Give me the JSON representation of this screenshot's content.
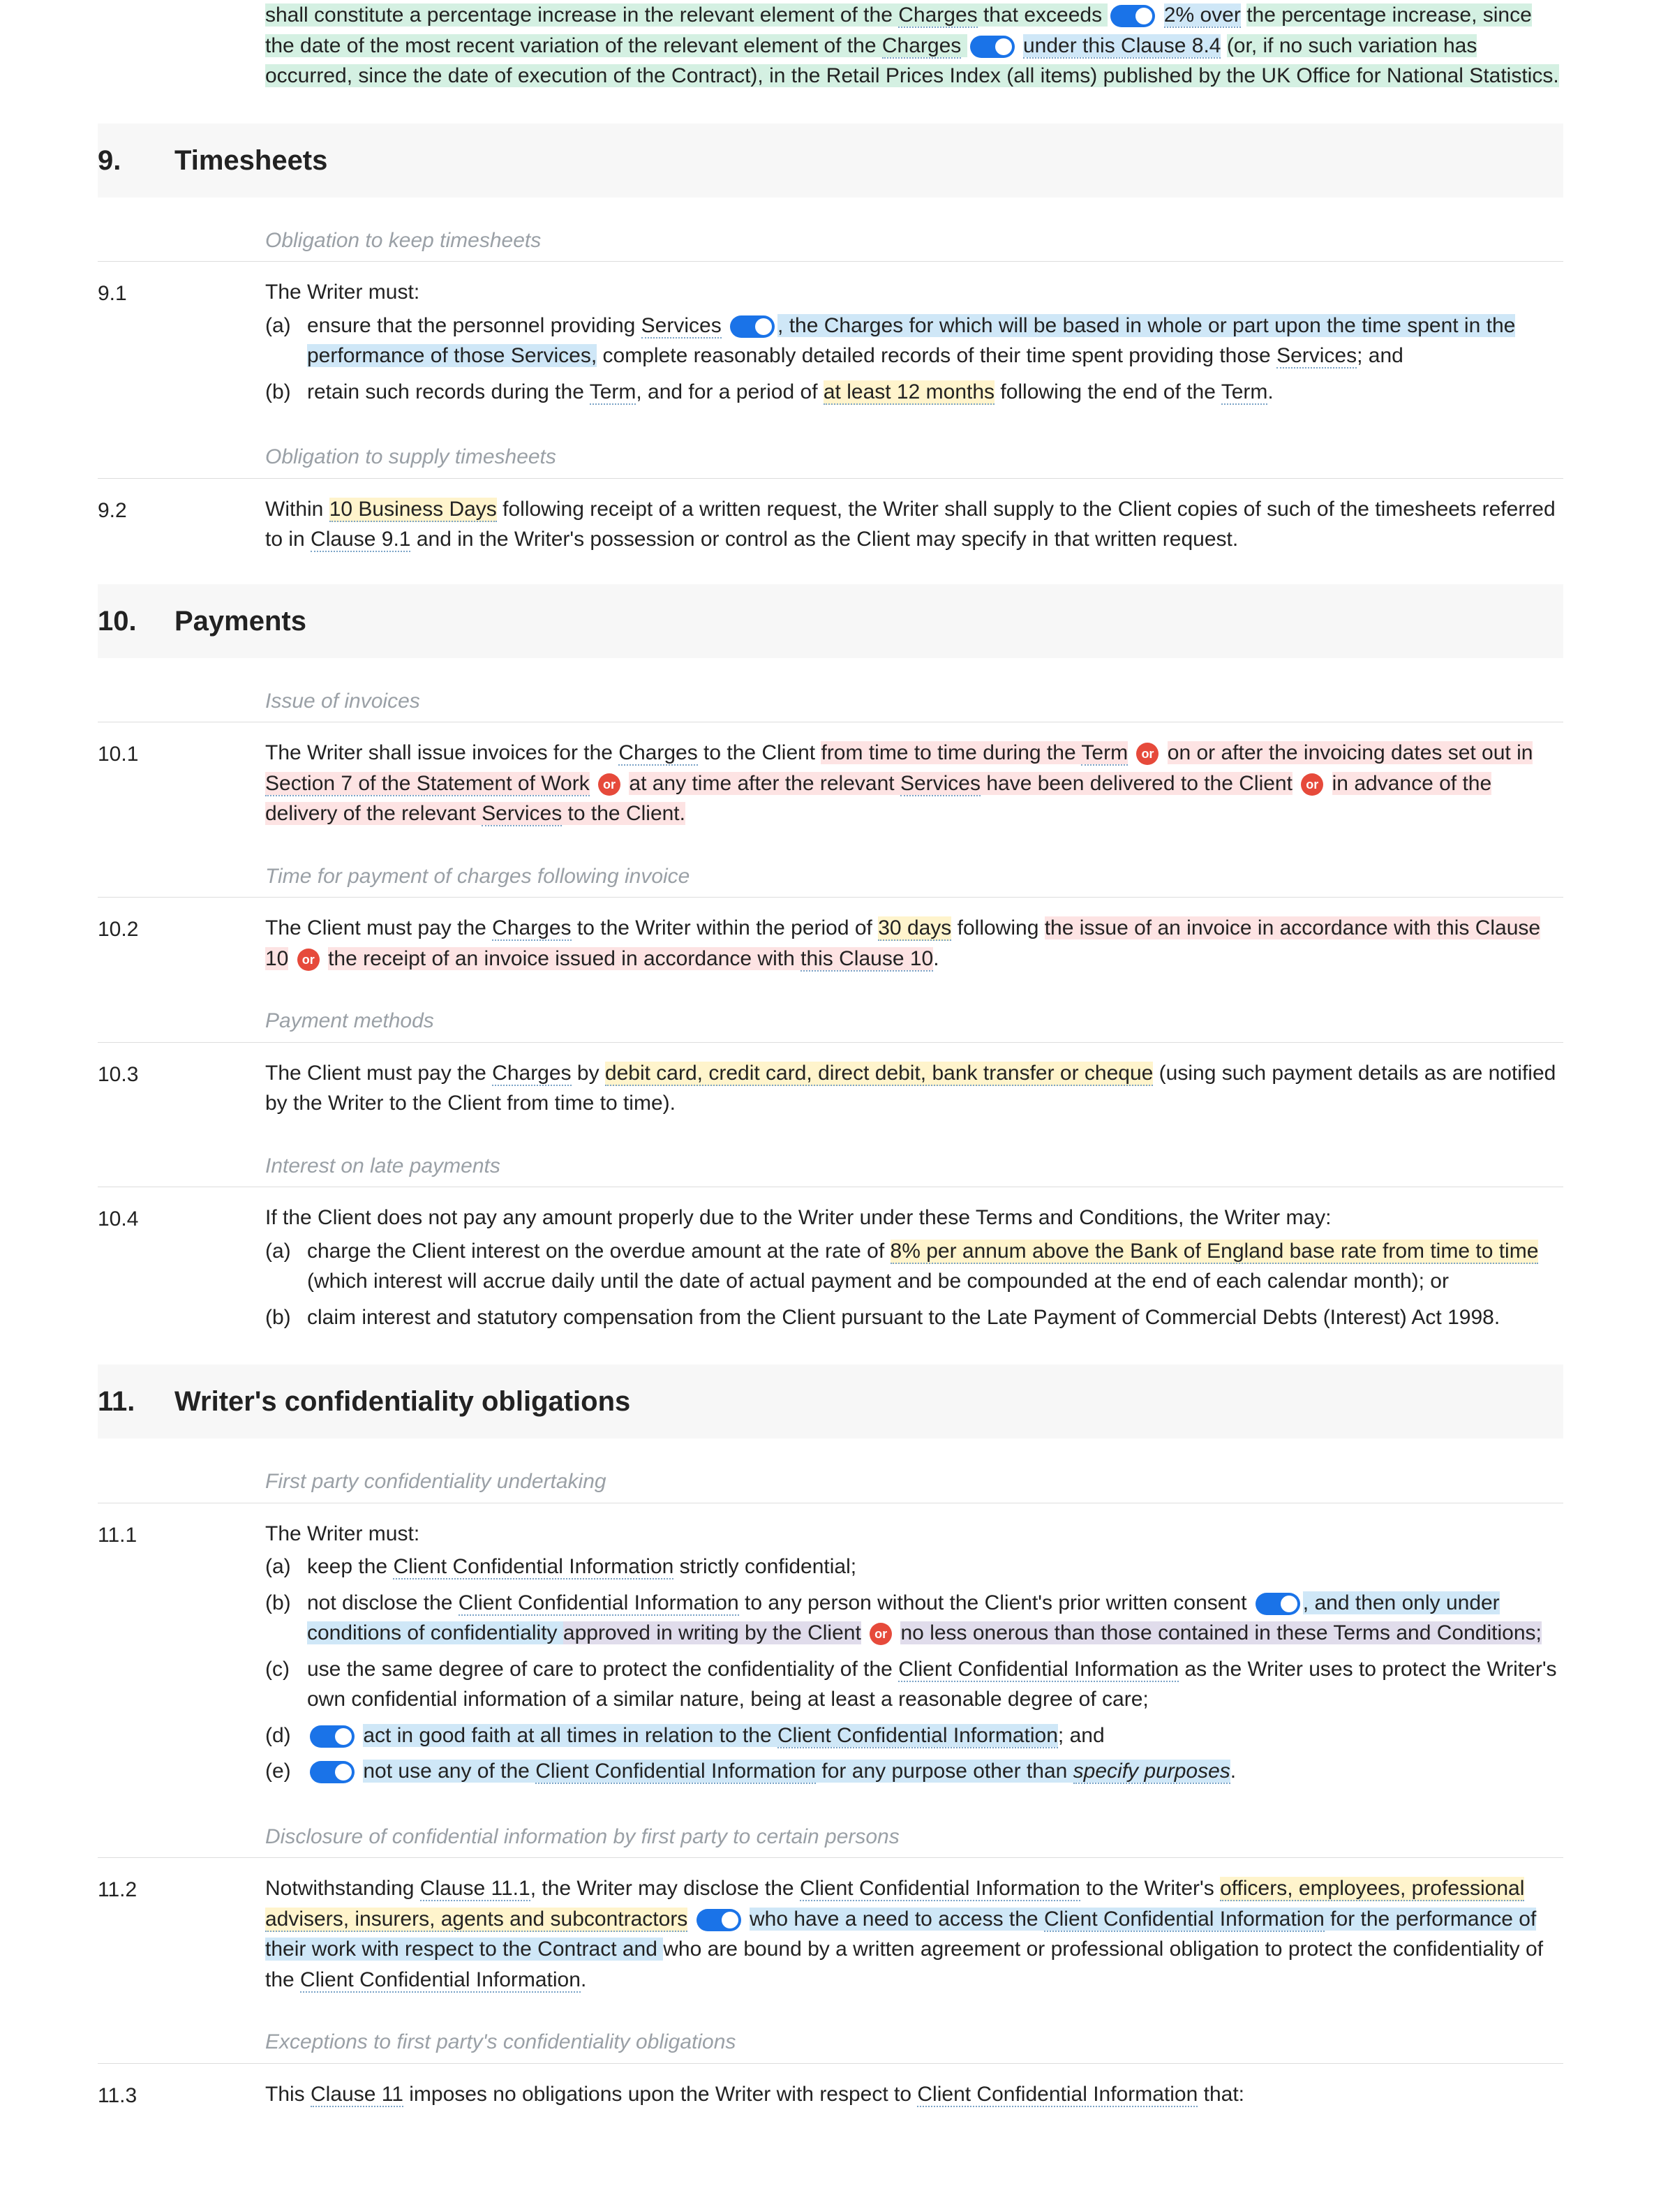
{
  "top": {
    "p1a": "shall constitute a percentage increase in the relevant element of the ",
    "charges": "Charges",
    "p1b": " that exceeds ",
    "pct": "2% over",
    "p1c": " the percentage increase, since the date of the most recent variation of the relevant element of the ",
    "p1d": "under this Clause 8.4",
    "p1e": " (or, if no such variation has occurred, since the date of execution of the Contract), in the Retail Prices Index (all items) published by the UK Office for National Statistics."
  },
  "s9": {
    "num": "9.",
    "title": "Timesheets",
    "cap1": "Obligation to keep timesheets",
    "c91n": "9.1",
    "c91lead": "The Writer must:",
    "c91a_l": "(a)",
    "c91a_1": "ensure that the personnel providing ",
    "services": "Services",
    "c91a_2": ", the Charges for which will be based in whole or part upon the time spent in the performance of those Services,",
    "c91a_3": " complete reasonably detailed records of their time spent providing those ",
    "c91a_4": "; and",
    "c91b_l": "(b)",
    "c91b_1": "retain such records during the ",
    "term": "Term",
    "c91b_2": ", and for a period of ",
    "c91b_3": "at least 12 months",
    "c91b_4": " following the end of the ",
    "c91b_5": ".",
    "cap2": "Obligation to supply timesheets",
    "c92n": "9.2",
    "c92_1": "Within ",
    "c92_2": "10 Business Days",
    "c92_3": " following receipt of a written request, the Writer shall supply to the Client copies of such of the timesheets referred to in ",
    "c92_4": "Clause 9.1",
    "c92_5": " and in the Writer's possession or control as the Client may specify in that written request."
  },
  "s10": {
    "num": "10.",
    "title": "Payments",
    "cap1": "Issue of invoices",
    "c101n": "10.1",
    "c101_1": "The Writer shall issue invoices for the ",
    "c101_2": " to the Client ",
    "c101_3": "from time to time during the ",
    "c101_4": " on or after the invoicing dates set out in ",
    "c101_5": "Section 7 of the Statement of Work",
    "c101_6": " at any time after the relevant ",
    "c101_7": " have been delivered to the Client",
    "c101_8": " in advance of the delivery of the relevant ",
    "c101_9": " to the Client.",
    "cap2": "Time for payment of charges following invoice",
    "c102n": "10.2",
    "c102_1": "The Client must pay the ",
    "c102_2": " to the Writer within the period of ",
    "c102_3": "30 days",
    "c102_4": " following ",
    "c102_5": "the issue of an invoice in accordance with this Clause 10",
    "c102_6": "the receipt of an invoice issued in accordance with ",
    "c102_7": "this Clause 10",
    "c102_8": ".",
    "cap3": "Payment methods",
    "c103n": "10.3",
    "c103_1": "The Client must pay the ",
    "c103_2": " by ",
    "c103_3": "debit card, credit card, direct debit, bank transfer or cheque",
    "c103_4": " (using such payment details as are notified by the Writer to the Client from time to time).",
    "cap4": "Interest on late payments",
    "c104n": "10.4",
    "c104lead": "If the Client does not pay any amount properly due to the Writer under these Terms and Conditions, the Writer may:",
    "c104a_l": "(a)",
    "c104a_1": "charge the Client interest on the overdue amount at the rate of ",
    "c104a_2": "8% per annum above the Bank of England base rate from time to time",
    "c104a_3": " (which interest will accrue daily until the date of actual payment and be compounded at the end of each calendar month); or",
    "c104b_l": "(b)",
    "c104b_1": "claim interest and statutory compensation from the Client pursuant to the Late Payment of Commercial Debts (Interest) Act 1998."
  },
  "s11": {
    "num": "11.",
    "title": "Writer's confidentiality obligations",
    "cap1": "First party confidentiality undertaking",
    "c111n": "11.1",
    "c111lead": "The Writer must:",
    "cci": "Client Confidential Information",
    "c111a_l": "(a)",
    "c111a_1": "keep the ",
    "c111a_2": " strictly confidential;",
    "c111b_l": "(b)",
    "c111b_1": "not disclose the ",
    "c111b_2": " to any person without the Client's prior written consent",
    "c111b_3": ", and then only under conditions of confidentiality ",
    "c111b_4": "approved in writing by the Client",
    "c111b_5": "no less onerous than those contained in these Terms and Conditions;",
    "c111c_l": "(c)",
    "c111c_1": "use the same degree of care to protect the confidentiality of the ",
    "c111c_2": " as the Writer uses to protect the Writer's own confidential information of a similar nature, being at least a reasonable degree of care;",
    "c111d_l": "(d)",
    "c111d_1": "act in good faith at all times in relation to the ",
    "c111d_2": "; and",
    "c111e_l": "(e)",
    "c111e_1": "not use any of the ",
    "c111e_2": " for any purpose other than ",
    "c111e_3": "specify purposes",
    "c111e_4": ".",
    "cap2": "Disclosure of confidential information by first party to certain persons",
    "c112n": "11.2",
    "c112_1": "Notwithstanding ",
    "c112_2": "Clause 11.1",
    "c112_3": ", the Writer may disclose the ",
    "c112_4": " to the Writer's ",
    "c112_5": "officers, employees, professional advisers, insurers, agents and subcontractors",
    "c112_6": "who have a need to access the ",
    "c112_7": " for the performance of their work with respect to the Contract and ",
    "c112_8": "who are bound by a written agreement or professional obligation to protect the confidentiality of the ",
    "c112_9": ".",
    "cap3": "Exceptions to first party's confidentiality obligations",
    "c113n": "11.3",
    "c113_1": "This ",
    "c113_2": "Clause 11",
    "c113_3": " imposes no obligations upon the Writer with respect to ",
    "c113_4": " that:"
  },
  "or": "or"
}
